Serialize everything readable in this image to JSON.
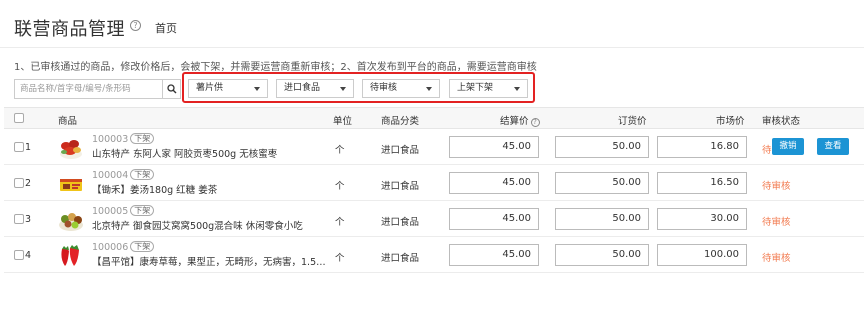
{
  "header": {
    "title": "联营商品管理",
    "help_icon": "help-icon",
    "breadcrumb": "首页"
  },
  "notice": "1、已审核通过的商品，修改价格后，会被下架，并需要运营商重新审核；2、首次发布到平台的商品，需要运营商审核",
  "search": {
    "placeholder": "商品名称/首字母/编号/条形码",
    "icon": "search-icon"
  },
  "filters": {
    "highlight_color": "#e32222",
    "supplier": "薯片供",
    "category": "进口食品",
    "audit_status": "待审核",
    "shelf_status": "上架下架"
  },
  "table": {
    "headers": {
      "product": "商品",
      "unit": "单位",
      "category": "商品分类",
      "settle_price": "结算价",
      "order_price": "订货价",
      "market_price": "市场价",
      "audit_status": "审核状态"
    },
    "rows": [
      {
        "index": "1",
        "code": "100003",
        "tag": "下架",
        "name": "山东特产 东阿人家 阿胶贡枣500g 无核蜜枣",
        "unit": "个",
        "category": "进口食品",
        "settle_price": "45.00",
        "order_price": "50.00",
        "market_price": "16.80",
        "status": "待审核",
        "actions": [
          "撤销",
          "查看"
        ]
      },
      {
        "index": "2",
        "code": "100004",
        "tag": "下架",
        "name": "【锄禾】姜汤180g 红糖 姜茶",
        "unit": "个",
        "category": "进口食品",
        "settle_price": "45.00",
        "order_price": "50.00",
        "market_price": "16.50",
        "status": "待审核"
      },
      {
        "index": "3",
        "code": "100005",
        "tag": "下架",
        "name": "北京特产 御食园艾窝窝500g混合味 休闲零食小吃",
        "unit": "个",
        "category": "进口食品",
        "settle_price": "45.00",
        "order_price": "50.00",
        "market_price": "30.00",
        "status": "待审核"
      },
      {
        "index": "4",
        "code": "100006",
        "tag": "下架",
        "name": "【昌平馆】康寿草莓，果型正，无畸形，无病害，1.5…",
        "unit": "个",
        "category": "进口食品",
        "settle_price": "45.00",
        "order_price": "50.00",
        "market_price": "100.00",
        "status": "待审核"
      }
    ]
  },
  "colors": {
    "status_pending": "#f27a4f",
    "action_button": "#1c94d4"
  }
}
